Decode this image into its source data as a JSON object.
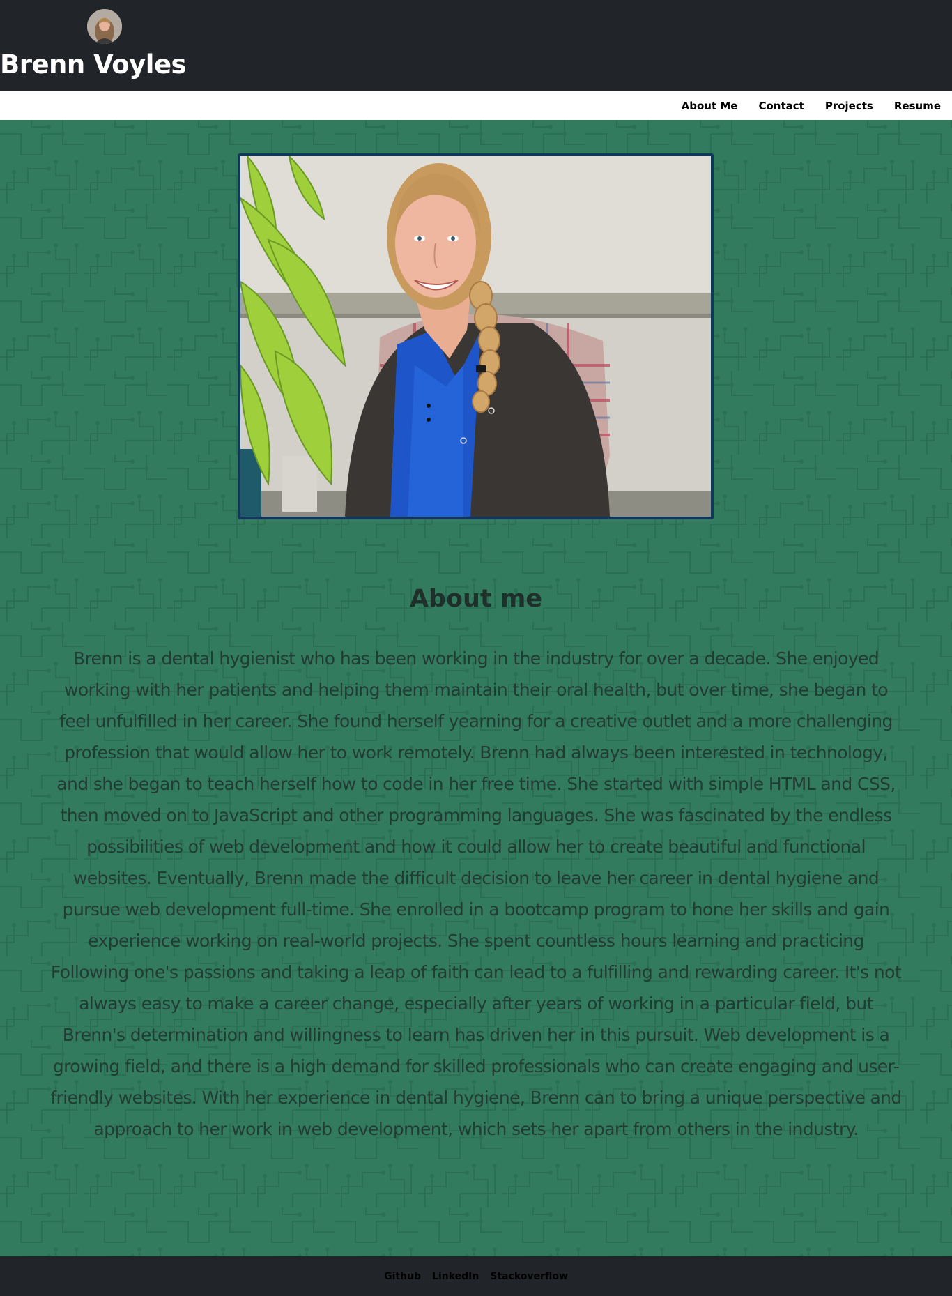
{
  "header": {
    "site_title": "Brenn Voyles",
    "avatar_alt": "Brenn Voyles avatar"
  },
  "nav": {
    "items": [
      {
        "label": "About Me"
      },
      {
        "label": "Contact"
      },
      {
        "label": "Projects"
      },
      {
        "label": "Resume"
      }
    ]
  },
  "main": {
    "photo_alt": "Photo of Brenn Voyles",
    "about_heading": "About me",
    "about_text": "Brenn is a dental hygienist who has been working in the industry for over a decade. She enjoyed working with her patients and helping them maintain their oral health, but over time, she began to feel unfulfilled in her career. She found herself yearning for a creative outlet and a more challenging profession that would allow her to work remotely. Brenn had always been interested in technology, and she began to teach herself how to code in her free time. She started with simple HTML and CSS, then moved on to JavaScript and other programming languages. She was fascinated by the endless possibilities of web development and how it could allow her to create beautiful and functional websites. Eventually, Brenn made the difficult decision to leave her career in dental hygiene and pursue web development full-time. She enrolled in a bootcamp program to hone her skills and gain experience working on real-world projects. She spent countless hours learning and practicing Following one's passions and taking a leap of faith can lead to a fulfilling and rewarding career. It's not always easy to make a career change, especially after years of working in a particular field, but Brenn's determination and willingness to learn has driven her in this pursuit. Web development is a growing field, and there is a high demand for skilled professionals who can create engaging and user-friendly websites. With her experience in dental hygiene, Brenn can to bring a unique perspective and approach to her work in web development, which sets her apart from others in the industry."
  },
  "footer": {
    "links": [
      {
        "label": "Github"
      },
      {
        "label": "LinkedIn"
      },
      {
        "label": "Stackoverflow"
      }
    ]
  },
  "colors": {
    "header_bg": "#212429",
    "nav_bg": "#ffffff",
    "page_bg": "#327b5f",
    "circuit_line": "#2a6e53",
    "photo_border": "#11385b",
    "heading_text": "#1f2f2a",
    "body_text": "#233c33",
    "footer_bg": "#212429"
  }
}
